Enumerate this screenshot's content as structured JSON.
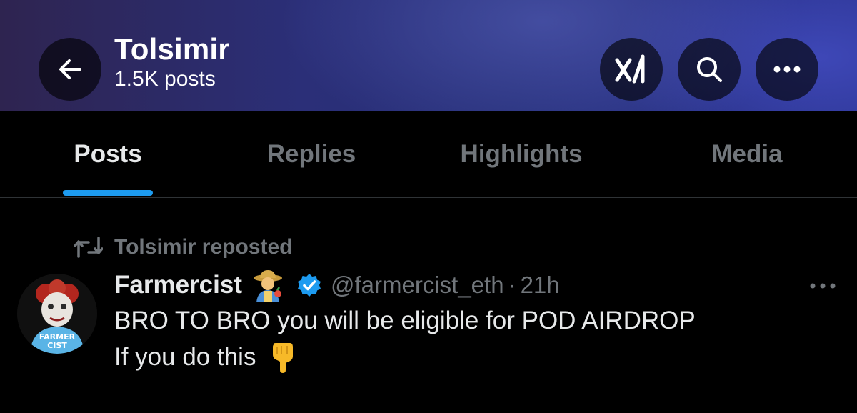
{
  "header": {
    "title": "Tolsimir",
    "post_count": "1.5K posts",
    "back_icon": "arrow-left-icon",
    "grok_icon": "grok-icon",
    "search_icon": "search-icon",
    "more_icon": "more-horizontal-icon",
    "gradient_colors": [
      "#2e2450",
      "#2b2f78",
      "#2b3390"
    ]
  },
  "tabs": [
    {
      "label": "Posts",
      "active": true
    },
    {
      "label": "Replies",
      "active": false
    },
    {
      "label": "Highlights",
      "active": false
    },
    {
      "label": "Media",
      "active": false
    }
  ],
  "post": {
    "repost_label": "Tolsimir reposted",
    "repost_icon": "repost-icon",
    "author": {
      "display_name": "Farmercist",
      "name_emoji": "farmer-emoji",
      "verified": true,
      "handle": "@farmercist_eth",
      "separator": "·",
      "time": "21h",
      "avatar_text": [
        "FARMER",
        "CIST"
      ]
    },
    "text_lines": [
      "BRO TO BRO you will be eligible for POD AIRDROP",
      "If you do this"
    ],
    "trailing_emoji": "backhand-index-pointing-down-emoji",
    "more_icon": "more-horizontal-icon"
  },
  "colors": {
    "accent": "#1d9bf0",
    "primary_text": "#e7e9ea",
    "secondary_text": "#71767b",
    "background": "#000000",
    "divider": "#2f3336"
  }
}
